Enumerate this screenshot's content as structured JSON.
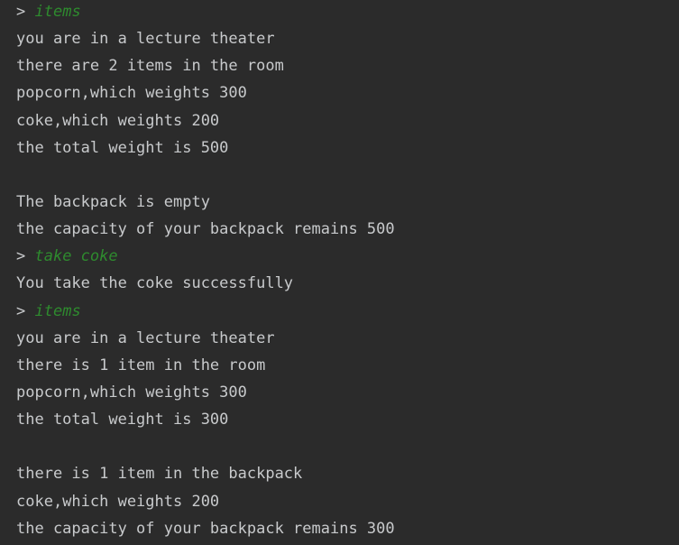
{
  "console": {
    "prompt_symbol": ">",
    "lines": [
      {
        "kind": "cmd",
        "text": "items"
      },
      {
        "kind": "out",
        "text": "you are in a lecture theater"
      },
      {
        "kind": "out",
        "text": "there are 2 items in the room"
      },
      {
        "kind": "out",
        "text": "popcorn,which weights 300"
      },
      {
        "kind": "out",
        "text": "coke,which weights 200"
      },
      {
        "kind": "out",
        "text": "the total weight is 500"
      },
      {
        "kind": "out",
        "text": ""
      },
      {
        "kind": "out",
        "text": "The backpack is empty"
      },
      {
        "kind": "out",
        "text": "the capacity of your backpack remains 500"
      },
      {
        "kind": "cmd",
        "text": "take coke"
      },
      {
        "kind": "out",
        "text": "You take the coke successfully"
      },
      {
        "kind": "cmd",
        "text": "items"
      },
      {
        "kind": "out",
        "text": "you are in a lecture theater"
      },
      {
        "kind": "out",
        "text": "there is 1 item in the room"
      },
      {
        "kind": "out",
        "text": "popcorn,which weights 300"
      },
      {
        "kind": "out",
        "text": "the total weight is 300"
      },
      {
        "kind": "out",
        "text": ""
      },
      {
        "kind": "out",
        "text": "there is 1 item in the backpack"
      },
      {
        "kind": "out",
        "text": "coke,which weights 200"
      },
      {
        "kind": "out",
        "text": "the capacity of your backpack remains 300"
      }
    ]
  },
  "colors": {
    "background": "#2b2b2b",
    "output_text": "#c8cacc",
    "command_text": "#2e8b2e"
  }
}
